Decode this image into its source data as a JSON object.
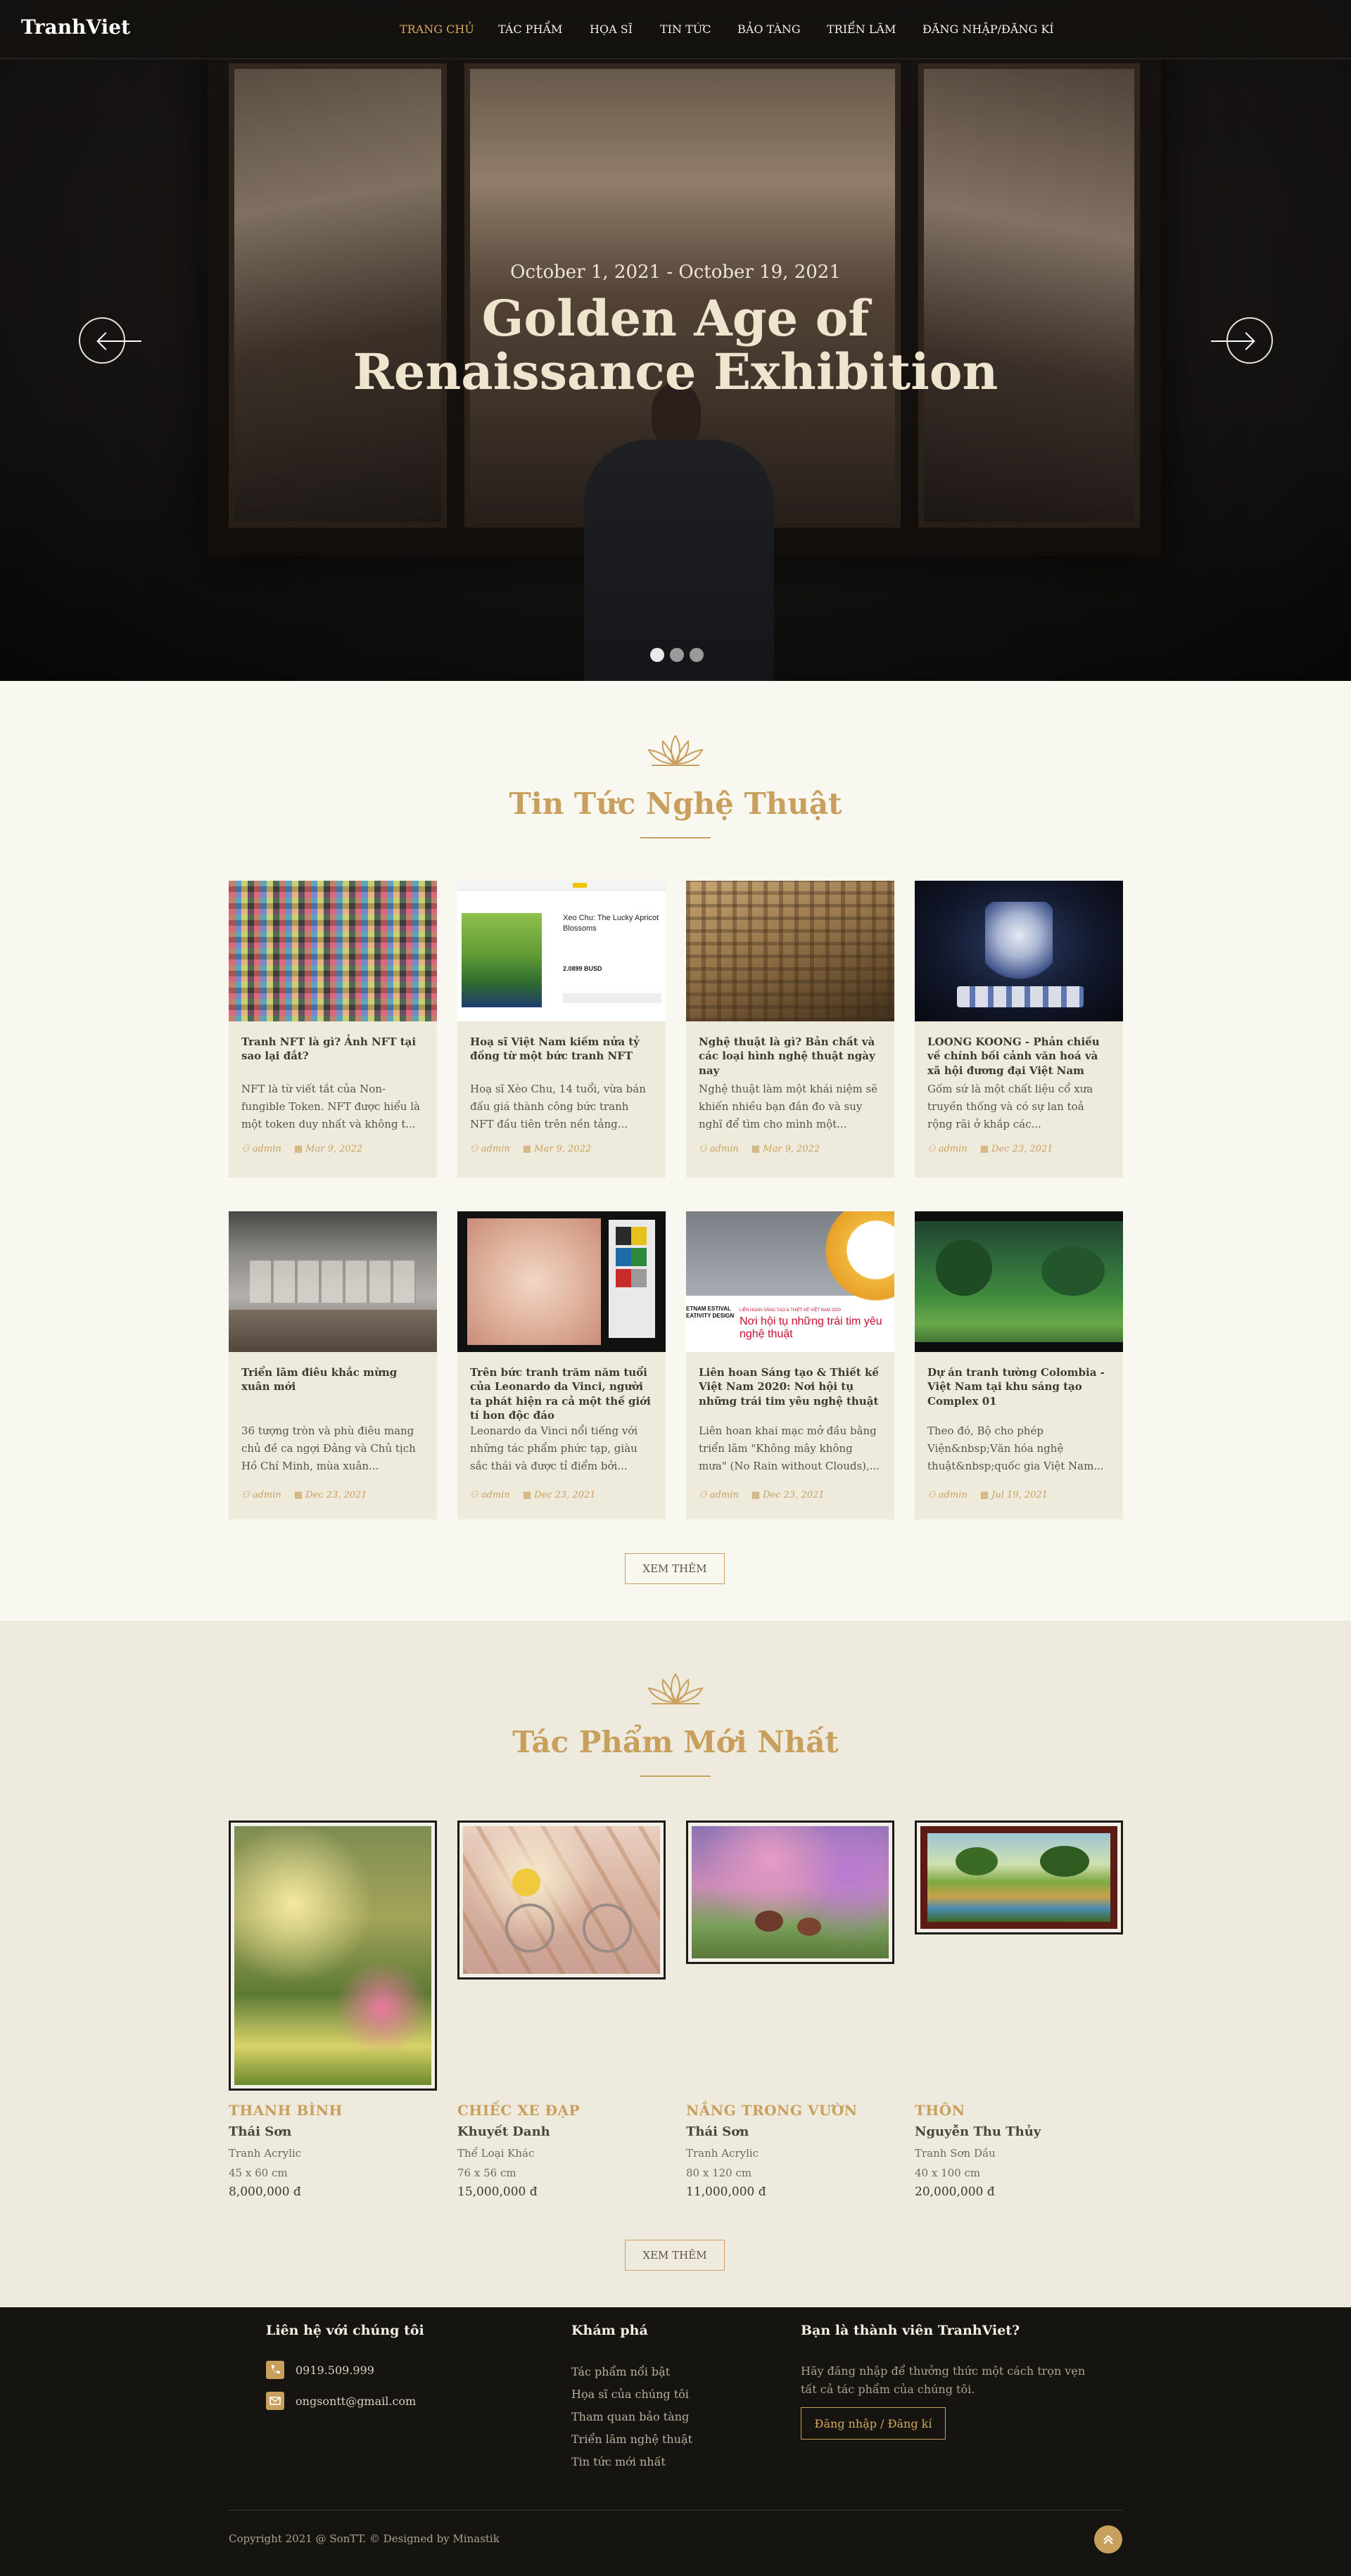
{
  "nav": {
    "logo": "TranhViet",
    "items": [
      "TRANG CHỦ",
      "TÁC PHẨM",
      "HỌA SĨ",
      "TIN TỨC",
      "BẢO TÀNG",
      "TRIỂN LÃM",
      "ĐĂNG NHẬP/ĐĂNG KÍ"
    ],
    "active_index": 0
  },
  "hero": {
    "date": "October 1, 2021 - October 19, 2021",
    "title": "Golden Age of Renaissance Exhibition",
    "slides_count": 3,
    "active_slide": 0
  },
  "news": {
    "title": "Tin Tức Nghệ Thuật",
    "more_button": "XEM THÊM",
    "cards": [
      {
        "title": "Tranh NFT là gì? Ảnh NFT tại sao lại đắt?",
        "excerpt": "NFT là từ viết tắt của Non-fungible Token. NFT được hiểu là một token duy nhất và không t...",
        "author": "admin",
        "date": "Mar 9, 2022"
      },
      {
        "title": "Hoạ sĩ Việt Nam kiếm nửa tỷ đồng từ một bức tranh NFT",
        "excerpt": "Hoạ sĩ Xèo Chu, 14 tuổi, vừa bán đấu giá thành công bức tranh NFT đầu tiên trên nền tảng...",
        "author": "admin",
        "date": "Mar 9, 2022"
      },
      {
        "title": "Nghệ thuật là gì? Bản chất và các loại hình nghệ thuật ngày nay",
        "excerpt": "Nghệ thuật làm một khái niệm sẽ khiến nhiều bạn đắn đo và suy nghĩ để tìm cho mình một...",
        "author": "admin",
        "date": "Mar 9, 2022"
      },
      {
        "title": "LOONG KOONG - Phản chiếu về chính bối cảnh văn hoá và xã hội đương đại Việt Nam",
        "excerpt": "Gốm sứ là một chất liệu cổ xưa truyền thống và có sự lan toả rộng rãi ở khắp các...",
        "author": "admin",
        "date": "Dec 23, 2021"
      },
      {
        "title": "Triển lãm điêu khắc mừng xuân mới",
        "excerpt": "36 tượng tròn và phù điêu mang chủ đề ca ngợi Đảng và Chủ tịch Hồ Chí Minh, mùa xuân...",
        "author": "admin",
        "date": "Dec 23, 2021"
      },
      {
        "title": "Trên bức tranh trăm năm tuổi của Leonardo da Vinci, người ta phát hiện ra cả một thế giới tí hon độc đáo",
        "excerpt": "Leonardo da Vinci nổi tiếng với những tác phẩm phức tạp, giàu sắc thái và được tỉ điểm bởi...",
        "author": "admin",
        "date": "Dec 23, 2021"
      },
      {
        "title": "Liên hoan Sáng tạo & Thiết kế Việt Nam 2020: Nơi hội tụ những trái tim yêu nghệ thuật",
        "excerpt": "Liên hoan khai mạc mở đầu bằng triển lãm \"Không mây không mưa\" (No Rain without Clouds),...",
        "author": "admin",
        "date": "Dec 23, 2021"
      },
      {
        "title": "Dự án tranh tường Colombia - Việt Nam tại khu sáng tạo Complex 01",
        "excerpt": "Theo đó, Bộ cho phép Viện&nbsp;Văn hóa nghệ thuật&nbsp;quốc gia Việt Nam...",
        "author": "admin",
        "date": "Jul 19, 2021"
      }
    ],
    "thumb_texts": {
      "nft_card_title": "Xeo Chu: The Lucky Apricot Blossoms",
      "nft_price": "2.0899 BUSD",
      "festival_line1": "LIÊN HOAN SÁNG TẠO & THIẾT KẾ VIỆT NAM 2020",
      "festival_line2": "Nơi hội tụ những trái tim yêu nghệ thuật",
      "festival_side": "ETNAM ESTIVAL EATIVITY DESIGN"
    }
  },
  "artworks": {
    "title": "Tác Phẩm Mới Nhất",
    "more_button": "XEM THÊM",
    "items": [
      {
        "name": "THANH BÌNH",
        "artist": "Thái Sơn",
        "type": "Tranh Acrylic",
        "size": "45 x 60 cm",
        "price": "8,000,000 đ"
      },
      {
        "name": "CHIẾC XE ĐẠP",
        "artist": "Khuyết Danh",
        "type": "Thể Loại Khác",
        "size": "76 x 56 cm",
        "price": "15,000,000 đ"
      },
      {
        "name": "NẮNG TRONG VƯỜN",
        "artist": "Thái Sơn",
        "type": "Tranh Acrylic",
        "size": "80 x 120 cm",
        "price": "11,000,000 đ"
      },
      {
        "name": "THÔN",
        "artist": "Nguyễn Thu Thủy",
        "type": "Tranh Sơn Dầu",
        "size": "40 x 100 cm",
        "price": "20,000,000 đ"
      }
    ]
  },
  "footer": {
    "contact_title": "Liên hệ với chúng tôi",
    "phone": "0919.509.999",
    "email": "ongsontt@gmail.com",
    "explore_title": "Khám phá",
    "explore_links": [
      "Tác phẩm nổi bật",
      "Họa sĩ của chúng tôi",
      "Tham quan bảo tàng",
      "Triển lãm nghệ thuật",
      "Tin tức mới nhất"
    ],
    "member_title": "Bạn là thành viên TranhViet?",
    "member_text": "Hãy đăng nhập để thưởng thức một cách trọn vẹn tất cả tác phẩm của chúng tôi.",
    "member_button": "Đăng nhập / Đăng kí",
    "copyright": "Copyright 2021 @ SonTT. © Designed by Minastik"
  },
  "colors": {
    "accent": "#c89f5d",
    "nav_active": "#d6a95a",
    "footer_bg": "#151410",
    "section_alt_bg": "#eeebde"
  }
}
